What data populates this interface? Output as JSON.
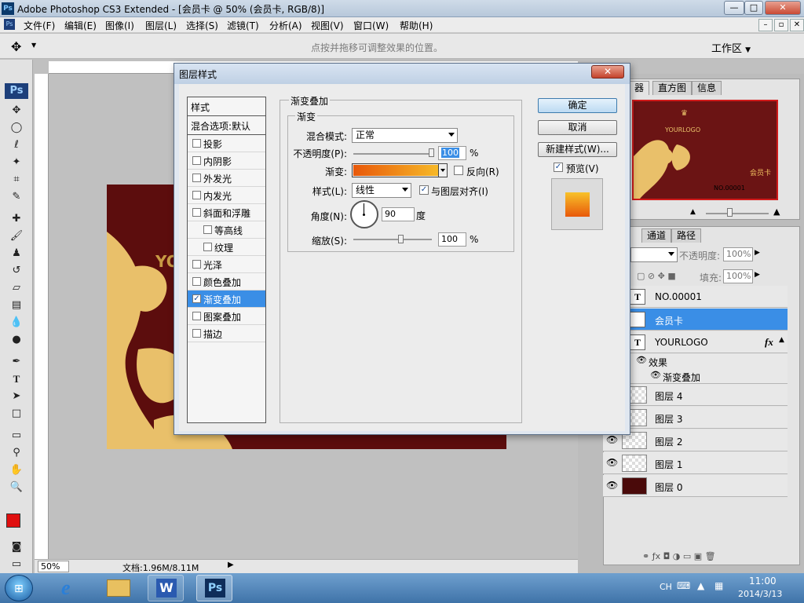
{
  "window": {
    "title": "Adobe Photoshop CS3 Extended - [会员卡 @ 50% (会员卡, RGB/8)]",
    "minimize": "—",
    "maximize": "□",
    "close": "✕"
  },
  "menu": [
    "文件(F)",
    "编辑(E)",
    "图像(I)",
    "图层(L)",
    "选择(S)",
    "滤镜(T)",
    "分析(A)",
    "视图(V)",
    "窗口(W)",
    "帮助(H)"
  ],
  "options_bar": {
    "hint": "点按并拖移可调整效果的位置。",
    "workspace": "工作区"
  },
  "status_bar": {
    "zoom": "50%",
    "doc_info": "文档:1.96M/8.11M"
  },
  "canvas": {
    "doc_text": "YO"
  },
  "dialog": {
    "title": "图层样式",
    "close": "✕",
    "styles_header": "样式",
    "blend_default": "混合选项:默认",
    "style_items": [
      {
        "label": "投影",
        "checked": false,
        "indent": false
      },
      {
        "label": "内阴影",
        "checked": false,
        "indent": false
      },
      {
        "label": "外发光",
        "checked": false,
        "indent": false
      },
      {
        "label": "内发光",
        "checked": false,
        "indent": false
      },
      {
        "label": "斜面和浮雕",
        "checked": false,
        "indent": false
      },
      {
        "label": "等高线",
        "checked": false,
        "indent": true
      },
      {
        "label": "纹理",
        "checked": false,
        "indent": true
      },
      {
        "label": "光泽",
        "checked": false,
        "indent": false
      },
      {
        "label": "颜色叠加",
        "checked": false,
        "indent": false
      },
      {
        "label": "渐变叠加",
        "checked": true,
        "indent": false
      },
      {
        "label": "图案叠加",
        "checked": false,
        "indent": false
      },
      {
        "label": "描边",
        "checked": false,
        "indent": false
      }
    ],
    "section_title": "渐变叠加",
    "subsection_title": "渐变",
    "blend_mode_label": "混合模式:",
    "blend_mode_value": "正常",
    "opacity_label": "不透明度(P):",
    "opacity_value": "100",
    "opacity_level": 1.0,
    "percent": "%",
    "gradient_label": "渐变:",
    "reverse_label": "反向(R)",
    "style_label": "样式(L):",
    "style_value": "线性",
    "align_label": "与图层对齐(I)",
    "align_checked": true,
    "angle_label": "角度(N):",
    "angle_value": "90",
    "degree": "度",
    "scale_label": "缩放(S):",
    "scale_value": "100",
    "buttons": {
      "ok": "确定",
      "cancel": "取消",
      "new_style": "新建样式(W)...",
      "preview": "预览(V)"
    },
    "preview_checked": true
  },
  "navigator": {
    "tabs": [
      "器",
      "直方图",
      "信息"
    ],
    "logo_text": "YOURLOGO",
    "card_text": "会员卡",
    "card_no": "NO.00001"
  },
  "layers_panel": {
    "tabs": [
      "通道",
      "路径"
    ],
    "opacity_label": "不透明度:",
    "opacity_value": "100%",
    "fill_label": "填充:",
    "fill_value": "100%",
    "layers": [
      {
        "name": "NO.00001",
        "type": "text",
        "selected": false,
        "visible": false
      },
      {
        "name": "会员卡",
        "type": "text",
        "selected": true,
        "visible": false
      },
      {
        "name": "YOURLOGO",
        "type": "text",
        "selected": false,
        "visible": false
      },
      {
        "name": "图层 4",
        "type": "pixel",
        "selected": false,
        "visible": false
      },
      {
        "name": "图层 3",
        "type": "pixel",
        "selected": false,
        "visible": false
      },
      {
        "name": "图层 2",
        "type": "pixel",
        "selected": false,
        "visible": true
      },
      {
        "name": "图层 1",
        "type": "pixel",
        "selected": false,
        "visible": true
      },
      {
        "name": "图层 0",
        "type": "fill",
        "selected": false,
        "visible": true
      }
    ],
    "effects_label": "效果",
    "effect_item": "渐变叠加"
  },
  "taskbar": {
    "lang": "CH",
    "time": "11:00",
    "date": "2014/3/13"
  },
  "colors": {
    "accent": "#3a8ee6",
    "gradient_start": "#e8580a",
    "gradient_end": "#f8c22a",
    "card_bg": "#5c0d0d"
  }
}
